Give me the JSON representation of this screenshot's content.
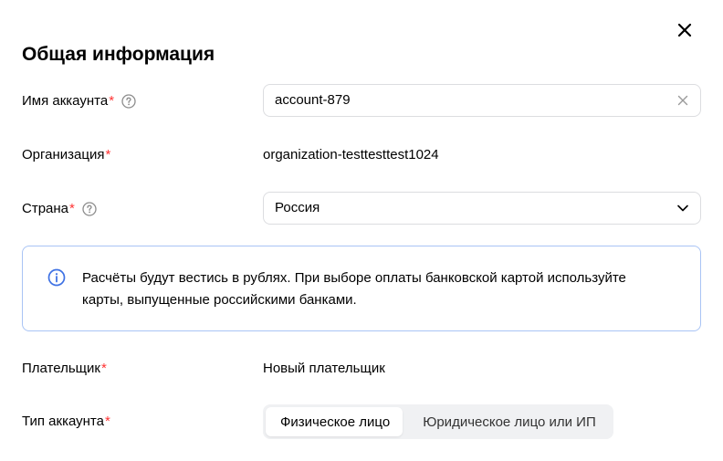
{
  "dialog": {
    "title": "Общая информация",
    "required_mark": "*"
  },
  "fields": {
    "account_name": {
      "label": "Имя аккаунта",
      "value": "account-879"
    },
    "organization": {
      "label": "Организация",
      "value": "organization-testtesttest1024"
    },
    "country": {
      "label": "Страна",
      "value": "Россия"
    },
    "payer": {
      "label": "Плательщик",
      "value": "Новый плательщик"
    },
    "account_type": {
      "label": "Тип аккаунта",
      "options": [
        "Физическое лицо",
        "Юридическое лицо или ИП"
      ],
      "selected": "Физическое лицо"
    }
  },
  "info": {
    "text": "Расчёты будут вестись в рублях. При выборе оплаты банковской картой используйте карты, выпущенные российскими банками."
  },
  "colors": {
    "required": "#ff3333",
    "info_border": "#a9c4f5",
    "info_icon": "#3f72e4",
    "field_border": "#dcdde0",
    "segment_bg": "#f0f1f3"
  },
  "icons": {
    "close": "close-icon",
    "help": "question-circle-icon",
    "clear": "clear-icon",
    "chevron": "chevron-down-icon",
    "info": "info-circle-icon"
  }
}
